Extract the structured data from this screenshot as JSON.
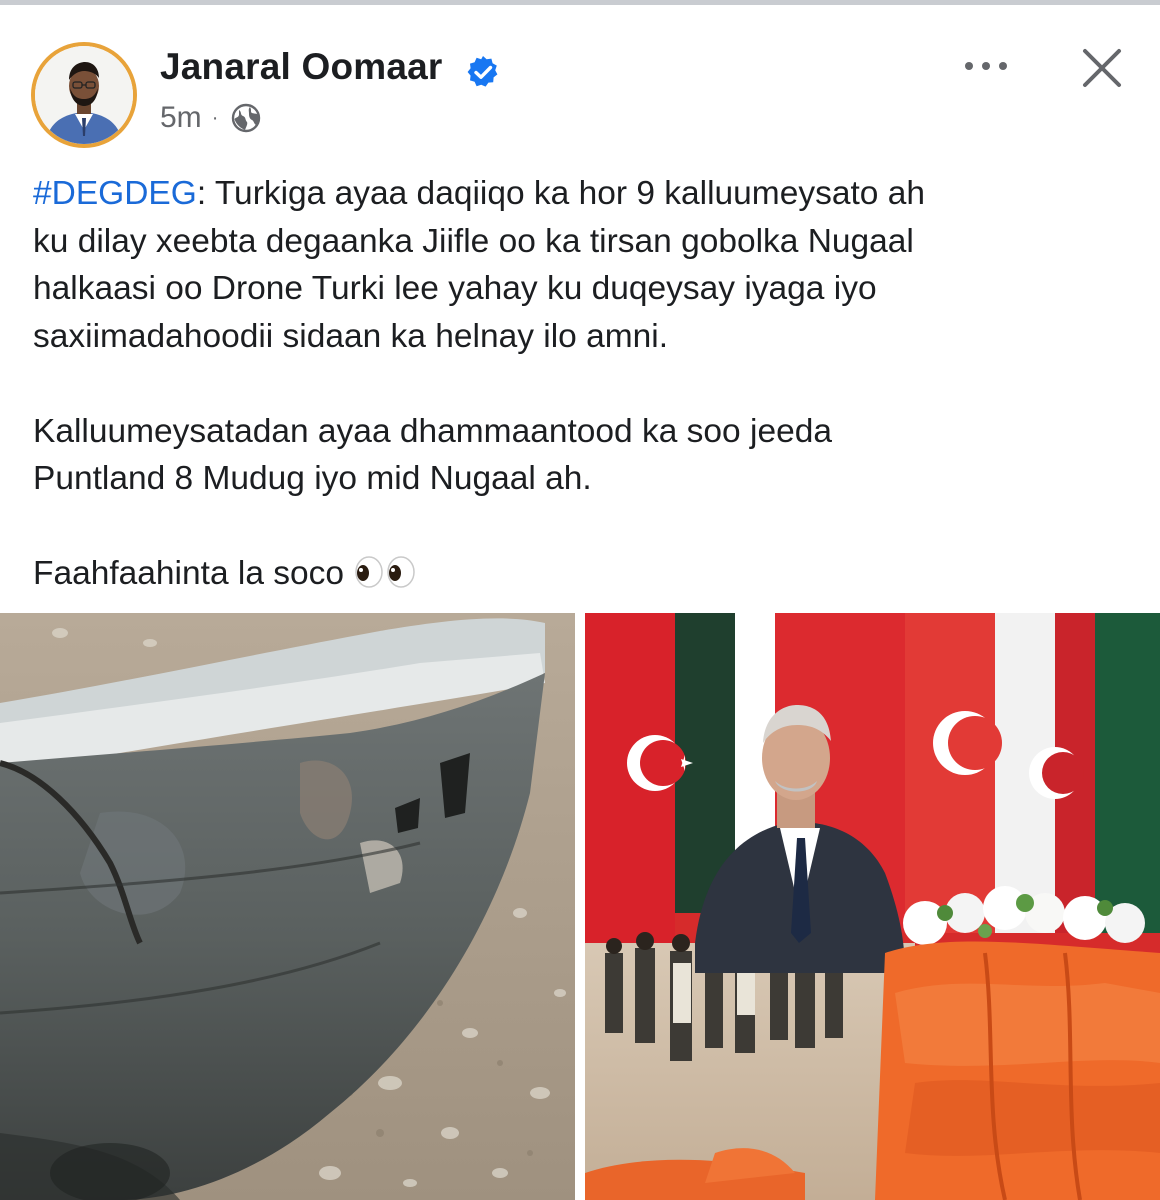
{
  "post": {
    "author": "Janaral Oomaar",
    "verified": true,
    "time": "5m",
    "separator": "·",
    "audience_icon": "globe-icon",
    "hashtag": "#DEGDEG",
    "paragraph1_rest": ": Turkiga ayaa daqiiqo ka hor 9 kalluumeysato ah",
    "paragraph1_lines": [
      "ku dilay xeebta degaanka Jiifle oo ka tirsan gobolka Nugaal",
      "halkaasi oo Drone Turki lee yahay ku duqeysay iyaga iyo",
      "saxiimadahoodii sidaan ka helnay ilo amni."
    ],
    "paragraph2_lines": [
      "Kalluumeysatadan ayaa dhammaantood ka soo jeeda",
      "Puntland 8 Mudug iyo mid Nugaal ah."
    ],
    "paragraph3": "Faahfaahinta la soco",
    "emoji": "eyes-emoji"
  },
  "colors": {
    "text": "#1c1e21",
    "secondary": "#65676b",
    "hashtag": "#1a6ad8",
    "verified": "#1877f2",
    "avatar_ring": "#e8a33a"
  },
  "images": [
    {
      "name": "damaged-boat-photo"
    },
    {
      "name": "turkey-president-collage-photo"
    }
  ]
}
